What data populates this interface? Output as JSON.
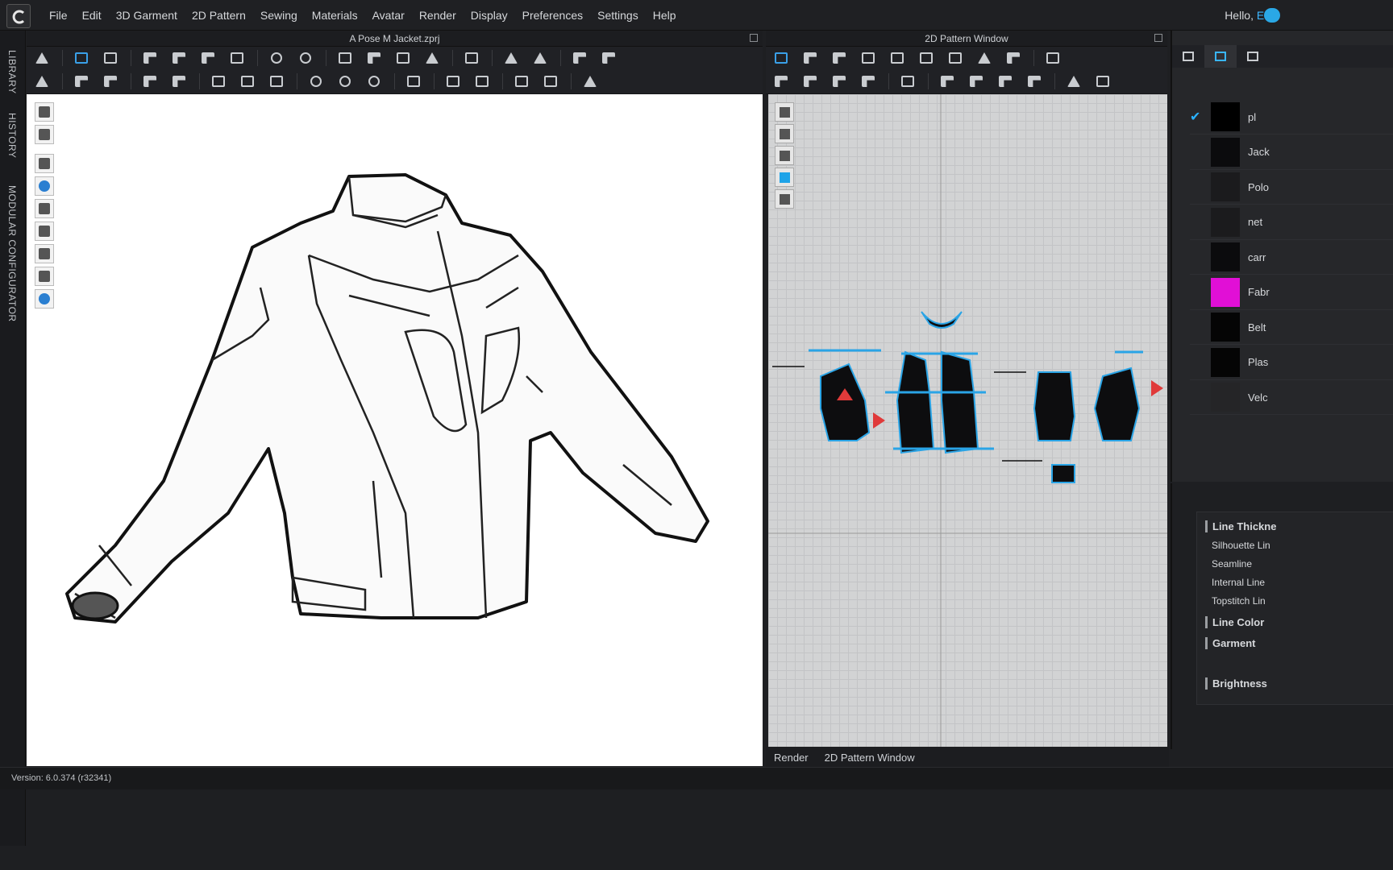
{
  "menu": {
    "items": [
      "File",
      "Edit",
      "3D Garment",
      "2D Pattern",
      "Sewing",
      "Materials",
      "Avatar",
      "Render",
      "Display",
      "Preferences",
      "Settings",
      "Help"
    ],
    "greeting": "Hello, ",
    "user": "Ed"
  },
  "sidebar": {
    "library": "LIBRARY",
    "history": "HISTORY",
    "modular": "MODULAR CONFIGURATOR"
  },
  "viewport": {
    "title": "A Pose M Jacket.zprj"
  },
  "pattern_window": {
    "title": "2D Pattern Window"
  },
  "bottom_tabs": [
    "Render",
    "2D Pattern Window"
  ],
  "status": {
    "version": "Version: 6.0.374 (r32341)"
  },
  "materials": [
    {
      "name": "pl",
      "color": "#000000",
      "checked": true
    },
    {
      "name": "Jack",
      "color": "#0b0b0d"
    },
    {
      "name": "Polo",
      "color": "#1b1b1d"
    },
    {
      "name": "net",
      "color": "#1b1b1d"
    },
    {
      "name": "carr",
      "color": "#0b0b0d"
    },
    {
      "name": "Fabr",
      "color": "#e10fd6"
    },
    {
      "name": "Belt",
      "color": "#050505"
    },
    {
      "name": "Plas",
      "color": "#050505"
    },
    {
      "name": "Velc",
      "color": "#252527"
    }
  ],
  "properties": {
    "line_thickness": "Line Thickne",
    "silhouette": "Silhouette Lin",
    "seamline": "Seamline",
    "internal": "Internal Line",
    "topstitch": "Topstitch Lin",
    "line_color": "Line Color",
    "garment": "Garment",
    "brightness": "Brightness"
  },
  "colors": {
    "accent": "#3db6ff",
    "magenta": "#e10fd6"
  }
}
